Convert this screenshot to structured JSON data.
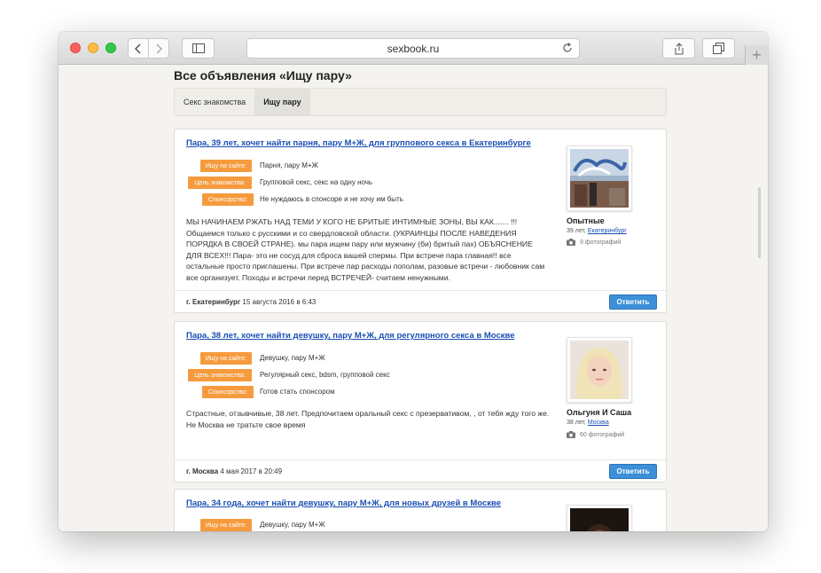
{
  "browser": {
    "url": "sexbook.ru",
    "icons": [
      "back-icon",
      "forward-icon",
      "sidebar-icon",
      "reload-icon",
      "share-icon",
      "tabs-icon",
      "plus-icon"
    ],
    "plus_label": "+"
  },
  "page": {
    "title": "Все объявления «Ищу пару»",
    "tabs": [
      {
        "label": "Секс знакомства",
        "active": false
      },
      {
        "label": "Ищу пару",
        "active": true
      }
    ]
  },
  "listings": [
    {
      "title": "Пара, 39 лет, хочет найти парня, пару М+Ж, для группового секса в Екатеринбурге",
      "fields": [
        {
          "label": "Ищу на сайте:",
          "value": "Парня, пару М+Ж"
        },
        {
          "label": "Цель знакомства:",
          "value": "Групповой секс, секс на одну ночь"
        },
        {
          "label": "Спонсорство:",
          "value": "Не нуждаюсь в спонсоре и не хочу им быть"
        }
      ],
      "description": "МЫ НАЧИНАЕМ РЖАТЬ НАД ТЕМИ У КОГО НЕ БРИТЫЕ ИНТИМНЫЕ ЗОНЫ, ВЫ КАК....... !!! Общаемся только с русскими и со свердловской области. (УКРАИНЦЫ ПОСЛЕ НАВЕДЕНИЯ ПОРЯДКА В СВОЕЙ СТРАНЕ). мы пара ищем пару или мужчину (би) бритый пах) ОБЪЯСНЕНИЕ ДЛЯ ВСЕХ!!! Пара- это не сосуд для сброса вашей спермы. При встрече пара главная!! все остальные просто приглашены. При встрече пар расходы пополам, разовые встречи - любовник сам все организует. Походы и встречи перед ВСТРЕЧЕЙ- считаем ненужными.",
      "city": "г. Екатеринбург",
      "date": "15 августа 2016 в 6:43",
      "reply_label": "Ответить",
      "user": {
        "name": "Опытные",
        "age": "39 лет,",
        "city": "Екатеринбург",
        "photos": "9 фотографий"
      }
    },
    {
      "title": "Пара, 38 лет, хочет найти девушку, пару М+Ж, для регулярного секса в Москве",
      "fields": [
        {
          "label": "Ищу на сайте:",
          "value": "Девушку, пару М+Ж"
        },
        {
          "label": "Цель знакомства:",
          "value": "Регулярный секс, bdsm, групповой секс"
        },
        {
          "label": "Спонсорство:",
          "value": "Готов стать спонсором"
        }
      ],
      "description": "Страстные, отзывчивые, 38 лет. Предпочитаем оральный секс с презервативом, , от тебя жду того же. Не Москва не тратьте свое время",
      "city": "г. Москва",
      "date": "4 мая 2017 в 20:49",
      "reply_label": "Ответить",
      "user": {
        "name": "Ольгуня И Саша",
        "age": "38 лет,",
        "city": "Москва",
        "photos": "60 фотографий"
      }
    },
    {
      "title": "Пара, 34 года, хочет найти девушку, пару М+Ж, для новых друзей в Москве",
      "fields": [
        {
          "label": "Ищу на сайте:",
          "value": "Девушку, пару М+Ж"
        }
      ]
    }
  ]
}
